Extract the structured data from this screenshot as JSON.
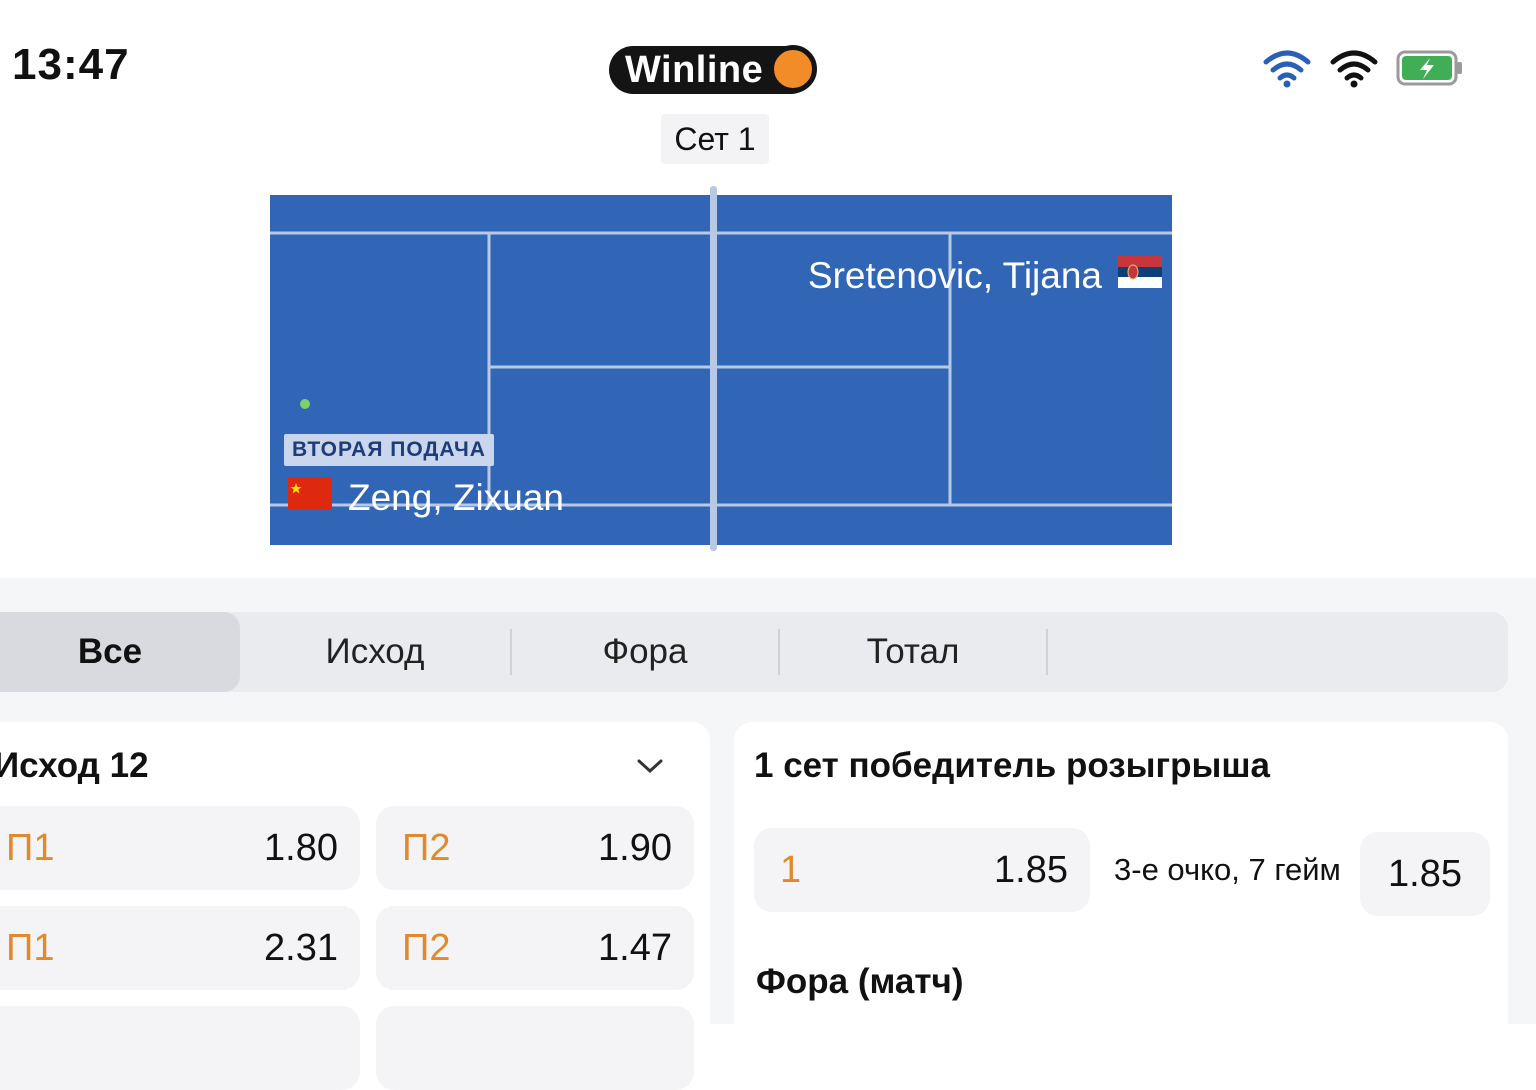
{
  "status_bar": {
    "time": "13:47",
    "brand": "Winline",
    "icons": [
      "wifi-icon",
      "wifi-icon",
      "battery-charging-icon"
    ]
  },
  "set_label": "Сет 1",
  "court": {
    "player_top": "Sretenovic, Tijana",
    "player_top_flag": "serbia-flag-icon",
    "player_bottom": "Zeng, Zixuan",
    "player_bottom_flag": "china-flag-icon",
    "serve_badge": "ВТОРАЯ ПОДАЧА",
    "colors": {
      "court": "#3066b5",
      "lines": "#b8c9e6",
      "ball": "#7dcf6b"
    }
  },
  "tabs": [
    "Все",
    "Исход",
    "Фора",
    "Тотал"
  ],
  "active_tab": "Все",
  "outcome_card": {
    "title": "Исход 12",
    "rows": [
      [
        {
          "label": "П1",
          "value": "1.80"
        },
        {
          "label": "П2",
          "value": "1.90"
        }
      ],
      [
        {
          "label": "П1",
          "value": "2.31"
        },
        {
          "label": "П2",
          "value": "1.47"
        }
      ]
    ]
  },
  "point_card": {
    "title": "1 сет победитель розыгрыша",
    "option": {
      "label": "1",
      "value": "1.85"
    },
    "middle_text": "3-е очко, 7 гейм",
    "option2": {
      "value": "1.85"
    },
    "subtitle": "Фора (матч)"
  },
  "accent_color": "#e08a2c"
}
